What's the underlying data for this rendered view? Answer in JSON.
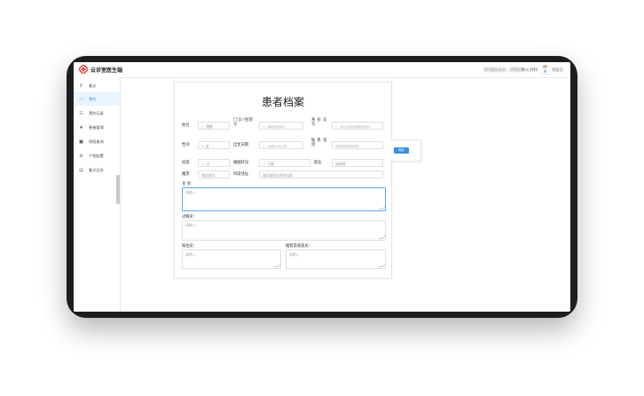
{
  "app": {
    "logo_text": "云诊室医生端",
    "brand_color": "#e8383d"
  },
  "user": {
    "dept_blurred": "陈X医生站点，北院区",
    "dept_visible": "胸-心外科",
    "name": "某医生"
  },
  "sidebar": {
    "items": [
      {
        "label": "看诊",
        "icon": "search-icon",
        "active": false
      },
      {
        "label": "预约",
        "icon": "calendar-icon",
        "active": true
      },
      {
        "label": "预约记录",
        "icon": "list-icon",
        "active": false
      },
      {
        "label": "患者管理",
        "icon": "pin-icon",
        "active": false
      },
      {
        "label": "排班查询",
        "icon": "grid-icon",
        "active": false
      },
      {
        "label": "个性配置",
        "icon": "gear-icon",
        "active": false
      },
      {
        "label": "看诊日志",
        "icon": "printer-icon",
        "active": false
      }
    ]
  },
  "form": {
    "title": "患者档案",
    "fields": {
      "name": {
        "label": "姓名",
        "value": "患者"
      },
      "mrn": {
        "label": "门诊/住院号",
        "value": "48500000"
      },
      "id_card": {
        "label": "身份证号",
        "value": "42110019800000"
      },
      "gender": {
        "label": "性别",
        "value": "女"
      },
      "birth": {
        "label": "出生日期",
        "value": "1985-05-03"
      },
      "phone": {
        "label": "联系电话",
        "value": "18900000000"
      },
      "ethnic": {
        "label": "民族",
        "value": "汉"
      },
      "marital": {
        "label": "婚姻状况",
        "value": "已婚"
      },
      "job": {
        "label": "职业",
        "value": "请选择"
      },
      "native": {
        "label": "籍贯",
        "value": "湖北武汉"
      },
      "address": {
        "label": "目前住址",
        "value": "湖北省武汉市洪山区"
      },
      "complaint": {
        "label": "主 诉:",
        "placeholder": "请输入"
      },
      "past_history": {
        "label": "过敏史:",
        "placeholder": "请输入"
      },
      "prev_history": {
        "label": "既往史:",
        "placeholder": "请输入"
      },
      "family_history": {
        "label": "婚育及家族史:",
        "placeholder": "请输入"
      }
    }
  },
  "side_card": {
    "button_label": "保存"
  }
}
